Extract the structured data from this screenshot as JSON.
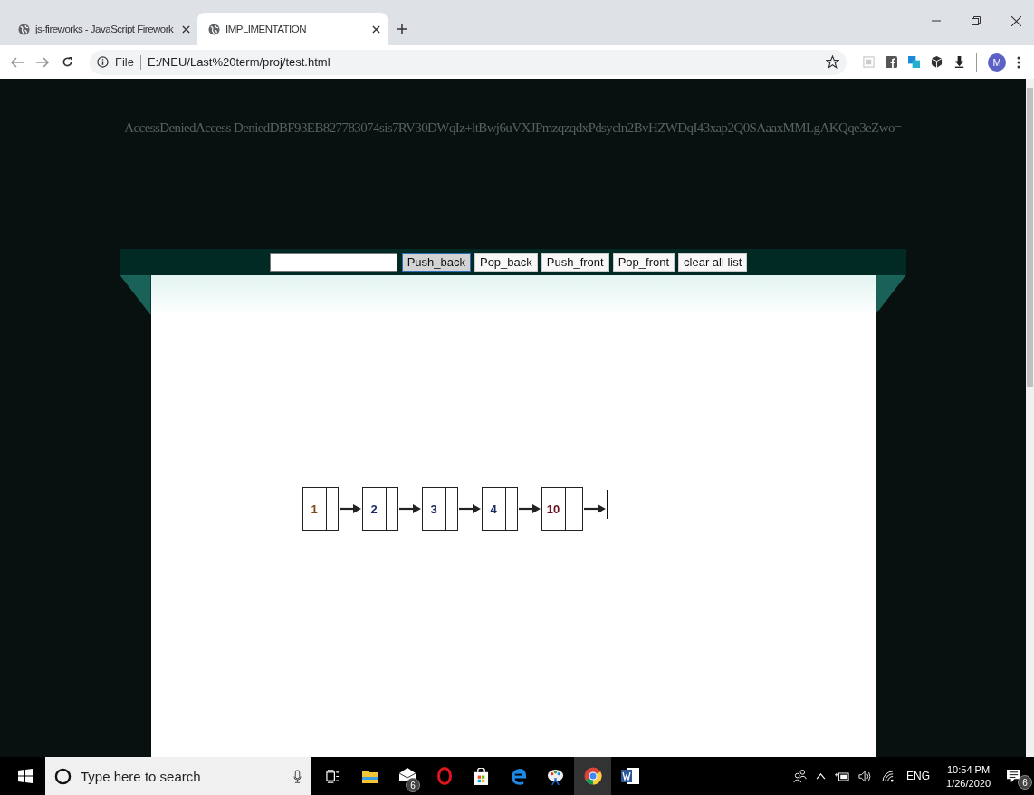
{
  "browser": {
    "tabs": [
      {
        "title": "js-fireworks - JavaScript Firework",
        "selected": false
      },
      {
        "title": "IMPLIMENTATION",
        "selected": true
      }
    ],
    "scheme": "File",
    "url": "E:/NEU/Last%20term/proj/test.html",
    "profile_initial": "M"
  },
  "page": {
    "message": "AccessDeniedAccess DeniedDBF93EB827783074sis7RV30DWqIz+ltBwj6uVXJPmzqzqdxPdsycln2BvHZWDqI43xap2Q0SAaaxMMLgAKQqe3eZwo=",
    "controls": {
      "buttons": [
        {
          "label": "Push_back",
          "focused": true
        },
        {
          "label": "Pop_back",
          "focused": false
        },
        {
          "label": "Push_front",
          "focused": false
        },
        {
          "label": "Pop_front",
          "focused": false
        },
        {
          "label": "clear all list",
          "focused": false
        }
      ]
    },
    "list_nodes": [
      {
        "value": "1",
        "color": "#7a4a10"
      },
      {
        "value": "2",
        "color": "#1a2a60"
      },
      {
        "value": "3",
        "color": "#1a2a60"
      },
      {
        "value": "4",
        "color": "#1a2a60"
      },
      {
        "value": "10",
        "color": "#6a1020"
      }
    ]
  },
  "taskbar": {
    "search_placeholder": "Type here to search",
    "apps": [
      {
        "kind": "taskview",
        "active": false
      },
      {
        "kind": "folder",
        "active": false
      },
      {
        "kind": "mail",
        "active": false,
        "badge": "6"
      },
      {
        "kind": "opera",
        "active": false
      },
      {
        "kind": "store",
        "active": false
      },
      {
        "kind": "edge",
        "active": false
      },
      {
        "kind": "paint",
        "active": false
      },
      {
        "kind": "chrome",
        "active": true
      },
      {
        "kind": "word",
        "active": false
      }
    ],
    "language": "ENG",
    "time": "10:54 PM",
    "date": "1/26/2020",
    "notification_count": "6"
  }
}
